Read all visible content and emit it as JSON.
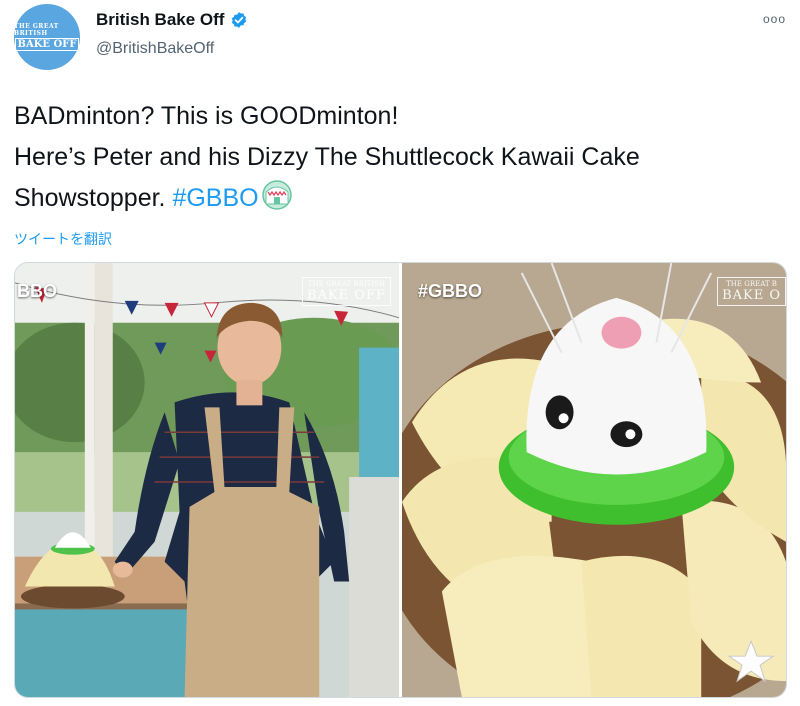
{
  "account": {
    "display_name": "British Bake Off",
    "handle": "@BritishBakeOff",
    "avatar_line1": "THE GREAT BRITISH",
    "avatar_line2": "BAKE OFF"
  },
  "more_label": "ooo",
  "tweet": {
    "line1": "BADminton? This is GOODminton!",
    "line2": "Here’s Peter and his Dizzy The Shuttlecock Kawaii Cake",
    "line3_text": "Showstopper. ",
    "hashtag": "#GBBO"
  },
  "translate_label": "ツイートを翻訳",
  "media": {
    "photo1": {
      "tag": "BBO",
      "wm_line1": "THE GREAT BRITISH",
      "wm_line2": "BAKE OFF"
    },
    "photo2": {
      "tag": "#GBBO",
      "wm_line1": "THE GREAT B",
      "wm_line2": "BAKE O"
    }
  },
  "colors": {
    "accent": "#1d9bf0",
    "text": "#0f1419",
    "secondary": "#536471"
  }
}
